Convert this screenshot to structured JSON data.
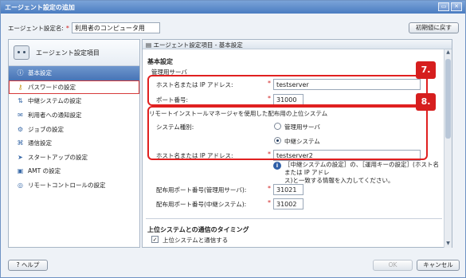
{
  "window": {
    "title": "エージェント設定の追加",
    "min_icon": "minimize-icon",
    "close_icon": "close-icon"
  },
  "agent_name": {
    "label": "エージェント設定名:",
    "required_mark": "*",
    "value": "利用者のコンピュータ用"
  },
  "reset_label": "初期値に戻す",
  "left": {
    "header": "エージェント設定項目",
    "items": [
      {
        "label": "基本設定",
        "icon": "info-icon"
      },
      {
        "label": "パスワードの設定",
        "icon": "key-icon"
      },
      {
        "label": "中継システムの設定",
        "icon": "relay-icon"
      },
      {
        "label": "利用者への通知設定",
        "icon": "notify-icon"
      },
      {
        "label": "ジョブの設定",
        "icon": "job-icon"
      },
      {
        "label": "通信設定",
        "icon": "network-icon"
      },
      {
        "label": "スタートアップの設定",
        "icon": "startup-icon"
      },
      {
        "label": "AMT の設定",
        "icon": "amt-icon"
      },
      {
        "label": "リモートコントロールの設定",
        "icon": "remote-icon"
      }
    ]
  },
  "right": {
    "breadcrumb": "エージェント設定項目 - 基本設定",
    "section": "基本設定",
    "mgmt": {
      "title": "管理用サーバ",
      "host_label": "ホスト名または IP アドレス:",
      "host_value": "testserver",
      "port_label": "ポート番号:",
      "port_value": "31000"
    },
    "remote": {
      "title": "リモートインストールマネージャを使用した配布用の上位システム",
      "sys_label": "システム種別:",
      "opt1": "管理用サーバ",
      "opt2": "中継システム",
      "host_label": "ホスト名または IP アドレス:",
      "host_value": "testserver2"
    },
    "info_text1": "［中継システムの設定］の、［運用キーの設定］(ホスト名または IP アドレ",
    "info_text2": "ス)と一致する情報を入力してください。",
    "dist_mgmt_label": "配布用ポート番号(管理用サーバ):",
    "dist_mgmt_value": "31021",
    "dist_relay_label": "配布用ポート番号(中継システム):",
    "dist_relay_value": "31002",
    "timing_title": "上位システムとの通信のタイミング",
    "timing_check": "上位システムと通信する",
    "req": "*"
  },
  "badges": {
    "b7": "7.",
    "b8": "8."
  },
  "buttons": {
    "help": "ヘルプ",
    "ok": "OK",
    "cancel": "キャンセル"
  }
}
